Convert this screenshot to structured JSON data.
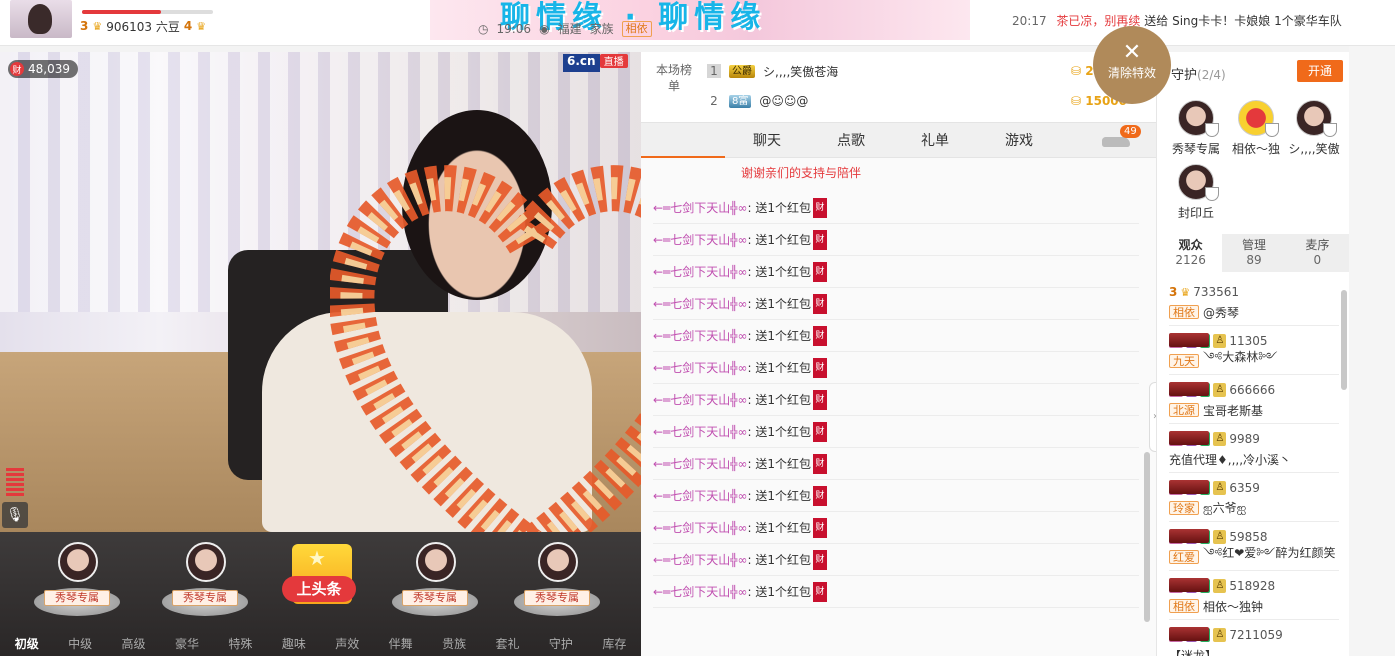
{
  "header": {
    "host_level": "3",
    "host_beans": "906103 六豆",
    "host_level2": "4",
    "progress": 0.6,
    "banner_title": "聊情缘 · 聊情缘",
    "time": "19:06",
    "location": "福建",
    "family_label": "家族",
    "family_name": "相依",
    "news_time": "20:17",
    "news_user": "茶已凉，别再续",
    "news_action": "送给",
    "news_target": "Sing卡卡！卡娘娘",
    "news_tail": "1个豪华车队"
  },
  "video": {
    "viewers": "48,039",
    "logo": "6.cn",
    "live": "直播"
  },
  "gifts": {
    "items": [
      {
        "label": "秀琴专属"
      },
      {
        "label": "秀琴专属"
      },
      {
        "label": "上头条"
      },
      {
        "label": "秀琴专属"
      },
      {
        "label": "秀琴专属"
      }
    ],
    "tabs": [
      "初级",
      "中级",
      "高级",
      "豪华",
      "特殊",
      "趣味",
      "声效",
      "伴舞",
      "贵族",
      "套礼",
      "守护",
      "库存"
    ]
  },
  "rank": {
    "title": "本场榜单",
    "rows": [
      {
        "num": "1",
        "badge": "公爵",
        "name": "シ,,,,笑傲苍海",
        "coins": "22222"
      },
      {
        "num": "2",
        "badge": "8富",
        "name": "@☺☺@",
        "coins": "15000"
      }
    ],
    "clear_label": "清除特效"
  },
  "chat_tabs": [
    "",
    "聊天",
    "点歌",
    "礼单",
    "游戏"
  ],
  "car_count": "49",
  "chat": {
    "pin": "谢谢亲们的支持与陪伴",
    "user": "←═七剑下天山╬∞",
    "action": ": 送1个红包",
    "cai": "财",
    "line_count": 13
  },
  "guard": {
    "title": "守护",
    "count": "(2/4)",
    "open": "开通",
    "members": [
      "秀琴专属",
      "相依～独",
      "シ,,,,笑傲",
      "封印丘"
    ]
  },
  "aud_tabs": [
    {
      "label": "观众",
      "n": "2126"
    },
    {
      "label": "管理",
      "n": "89"
    },
    {
      "label": "麦序",
      "n": "0"
    }
  ],
  "audience": [
    {
      "lvl": "3",
      "num": "733561",
      "tag": "相依",
      "name": "@秀琴"
    },
    {
      "lvl": "",
      "num": "11305",
      "tag": "九天",
      "name": "༺大森林༻"
    },
    {
      "lvl": "",
      "num": "666666",
      "tag": "北源",
      "name": "宝哥老斯基"
    },
    {
      "lvl": "",
      "num": "9989",
      "tag": "",
      "name": "充值代理♦,,,,冷小溪丶"
    },
    {
      "lvl": "",
      "num": "6359",
      "tag": "玲家",
      "name": "ஐ六爷ஐ"
    },
    {
      "lvl": "",
      "num": "59858",
      "tag": "红爱",
      "name": "༺红❤爱༻醉为红颜笑"
    },
    {
      "lvl": "",
      "num": "518928",
      "tag": "相依",
      "name": "相依～独钟"
    },
    {
      "lvl": "",
      "num": "7211059",
      "tag": "",
      "name": "【迷龙】"
    }
  ]
}
